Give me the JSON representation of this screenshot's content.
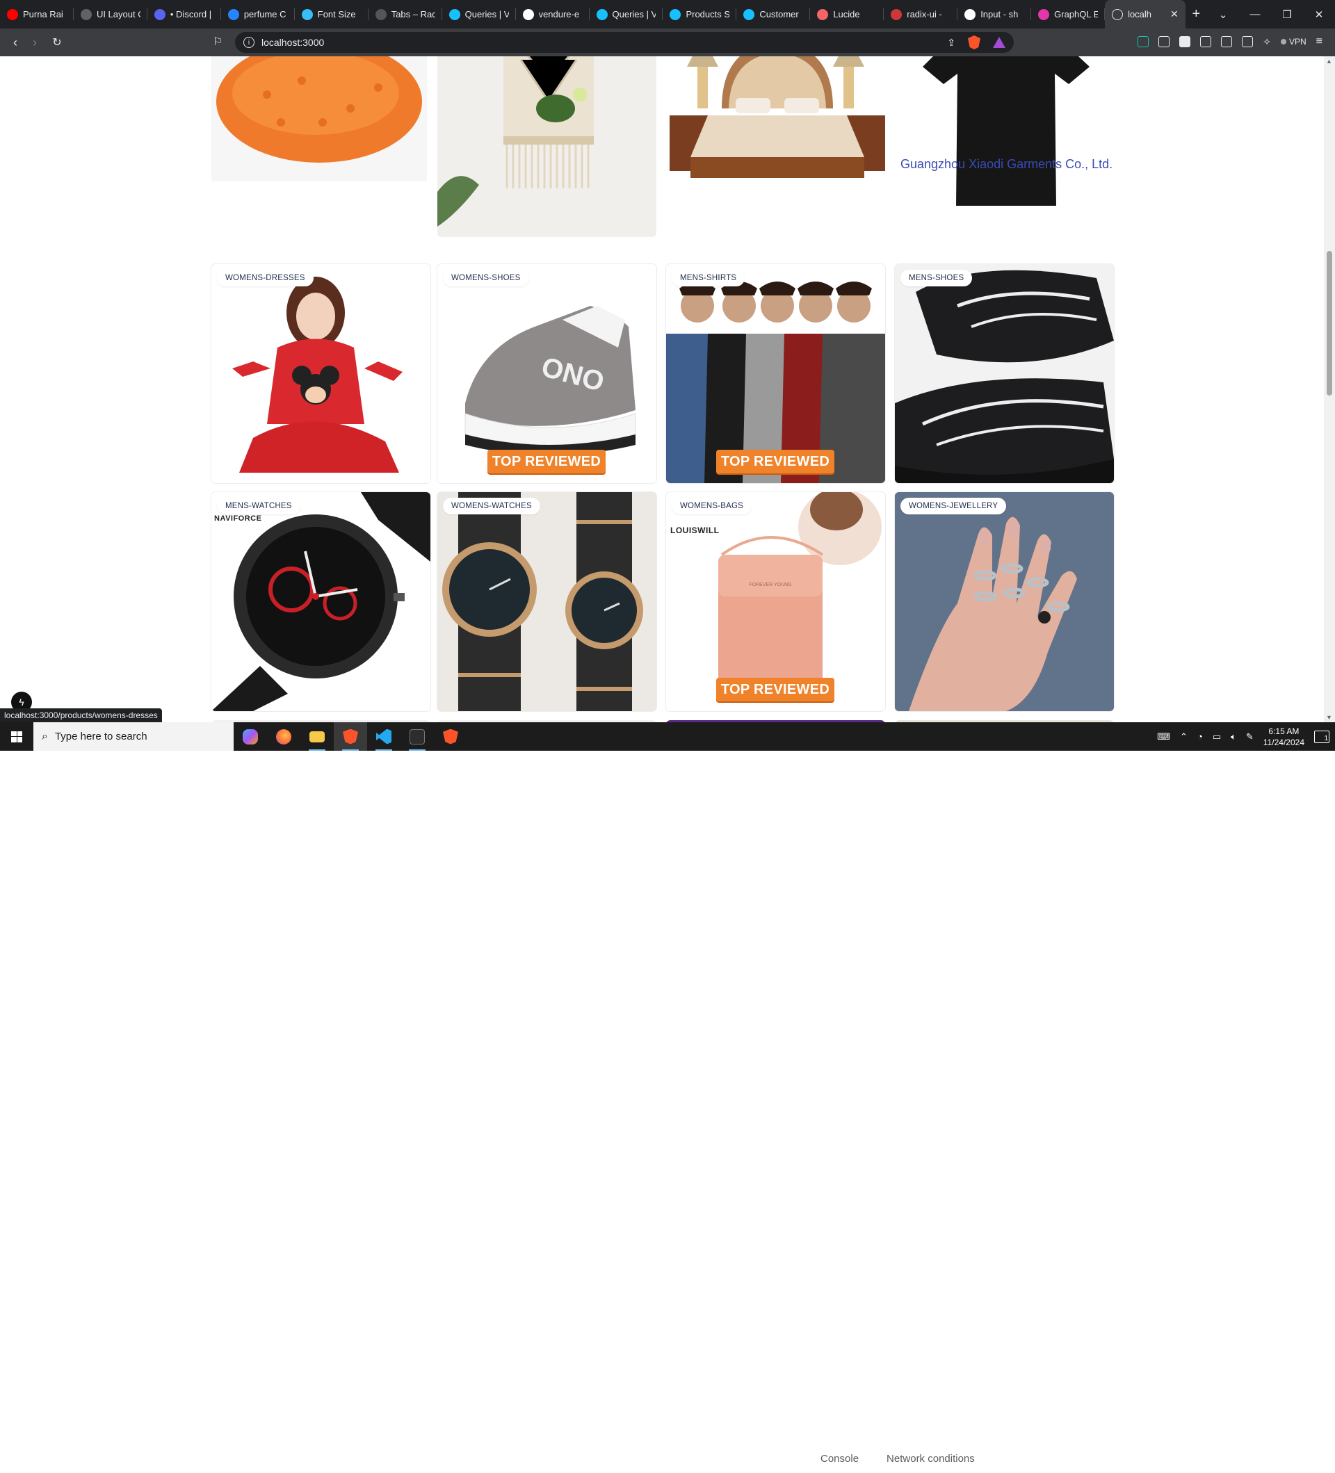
{
  "tabs": [
    {
      "title": "Purna Rai",
      "icon": "youtube-icon",
      "color": "#ff0000"
    },
    {
      "title": "UI Layout C",
      "icon": "globe-icon",
      "color": "#5f6368"
    },
    {
      "title": "• Discord |",
      "icon": "discord-icon",
      "color": "#5865f2"
    },
    {
      "title": "perfume C",
      "icon": "bitbucket-icon",
      "color": "#2684ff"
    },
    {
      "title": "Font Size",
      "icon": "tailwind-icon",
      "color": "#38bdf8"
    },
    {
      "title": "Tabs – Rad",
      "icon": "radix-icon",
      "color": "#555555"
    },
    {
      "title": "Queries | V",
      "icon": "vendure-icon",
      "color": "#17c1ff"
    },
    {
      "title": "vendure-e",
      "icon": "github-icon",
      "color": "#ffffff"
    },
    {
      "title": "Queries | V",
      "icon": "vendure-icon",
      "color": "#17c1ff"
    },
    {
      "title": "Products S",
      "icon": "vendure-icon",
      "color": "#17c1ff"
    },
    {
      "title": "Customer",
      "icon": "vendure-icon",
      "color": "#17c1ff"
    },
    {
      "title": "Lucide",
      "icon": "lucide-icon",
      "color": "#f56565"
    },
    {
      "title": "radix-ui -",
      "icon": "npm-icon",
      "color": "#cb3837"
    },
    {
      "title": "Input - sh",
      "icon": "shadcn-icon",
      "color": "#ffffff"
    },
    {
      "title": "GraphQL E",
      "icon": "graphql-icon",
      "color": "#e535ab"
    }
  ],
  "active_tab": {
    "title": "localh",
    "close": "✕"
  },
  "window_controls": {
    "minimize": "—",
    "restore": "❐",
    "close": "✕",
    "tab_search": "⌄",
    "new_tab": "+"
  },
  "address_bar": {
    "url": "localhost:3000"
  },
  "extensions": {
    "vpn_label": "VPN"
  },
  "products": [
    {
      "category": "",
      "image": "red-lentils",
      "ribbon": ""
    },
    {
      "category": "",
      "image": "macrame-wall-shelf",
      "ribbon": ""
    },
    {
      "category": "",
      "image": "luxury-bed",
      "ribbon": ""
    },
    {
      "category": "",
      "image": "black-tshirt",
      "ribbon": "",
      "watermark": "Guangzhou Xiaodi Garments Co., Ltd."
    },
    {
      "category": "WOMENS-DRESSES",
      "image": "red-mickey-pajamas",
      "ribbon": ""
    },
    {
      "category": "WOMENS-SHOES",
      "image": "grey-platform-sneaker",
      "ribbon": "TOP REVIEWED"
    },
    {
      "category": "MENS-SHIRTS",
      "image": "men-tshirts-group",
      "ribbon": "TOP REVIEWED"
    },
    {
      "category": "MENS-SHOES",
      "image": "black-white-sneakers",
      "ribbon": ""
    },
    {
      "category": "MENS-WATCHES",
      "image": "naviforce-watch",
      "ribbon": "",
      "logo": "NAVIFORCE"
    },
    {
      "category": "WOMENS-WATCHES",
      "image": "pair-gold-watches",
      "ribbon": ""
    },
    {
      "category": "WOMENS-BAGS",
      "image": "pink-crossbody-bag",
      "ribbon": "TOP REVIEWED",
      "logo": "LOUISWILL"
    },
    {
      "category": "WOMENS-JEWELLERY",
      "image": "silver-rings-hand",
      "ribbon": ""
    }
  ],
  "status_url": "localhost:3000/products/womens-dresses",
  "devtools": {
    "console": "Console",
    "network": "Network conditions"
  },
  "taskbar": {
    "search_placeholder": "Type here to search",
    "time": "6:15 AM",
    "date": "11/24/2024",
    "notifications": "1"
  }
}
